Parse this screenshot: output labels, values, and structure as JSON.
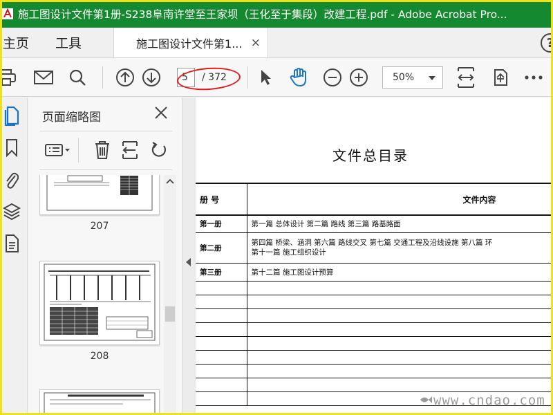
{
  "window": {
    "title": "施工图设计文件第1册-S238阜南许堂至王家坝（王化至于集段）改建工程.pdf - Adobe Acrobat Pro..."
  },
  "nav": {
    "home": "主页",
    "tools": "工具"
  },
  "tab": {
    "label": "施工图设计文件第1...",
    "close": "×"
  },
  "help_label": "?",
  "toolbar": {
    "current_page": "5",
    "page_total": "/ 372",
    "zoom": "50%"
  },
  "panel": {
    "title": "页面缩略图",
    "thumbnails": [
      {
        "label": "207"
      },
      {
        "label": "208"
      }
    ]
  },
  "document": {
    "title": "文件总目录",
    "table_headers": {
      "volume": "册  号",
      "content": "文件内容"
    },
    "rows": [
      {
        "volume": "第一册",
        "content": "第一篇 总体设计      第二篇 路线      第三篇 路基路面"
      },
      {
        "volume": "第二册",
        "content_line1": "第四篇 桥梁、涵洞      第六篇 路线交叉      第七篇 交通工程及沿线设施      第八篇 环",
        "content_line2": "第十一篇 施工组织设计"
      },
      {
        "volume": "第三册",
        "content": "第十二篇 施工图设计预算"
      }
    ]
  },
  "watermark": "www.cndao.com",
  "colors": {
    "titlebar": "#15892f",
    "highlight_ellipse": "#e31b1b",
    "frame": "#f0e21a"
  }
}
